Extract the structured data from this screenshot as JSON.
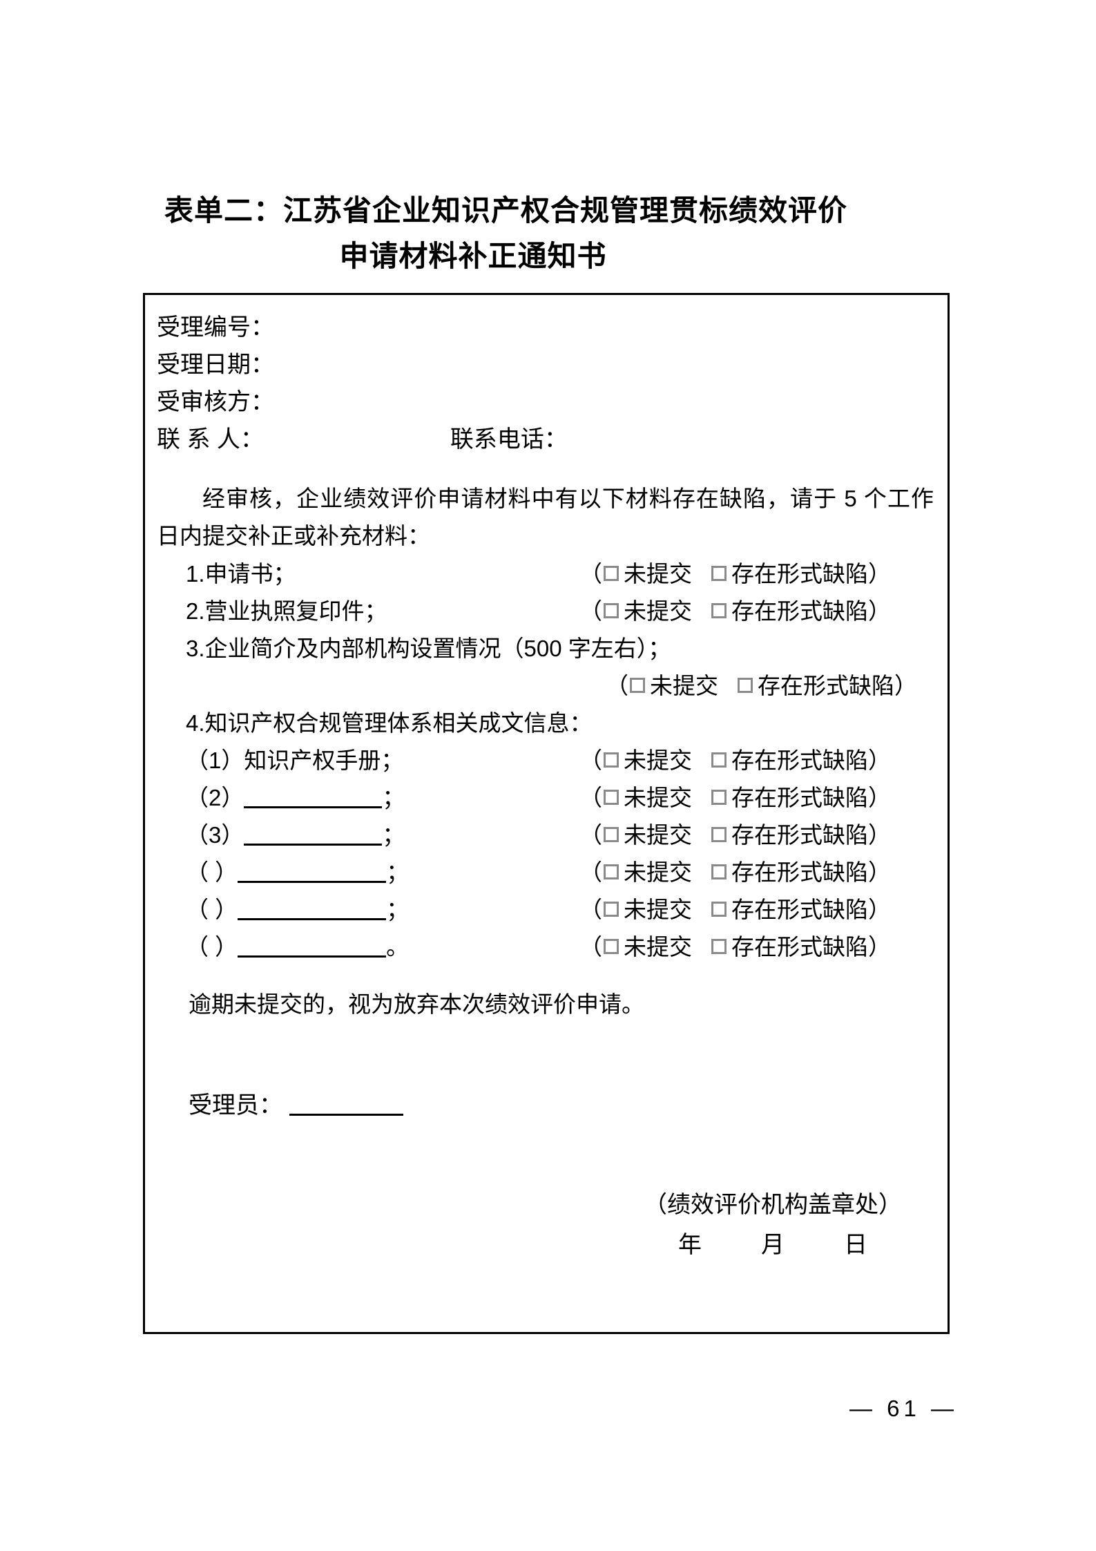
{
  "document": {
    "title_line_1": "表单二：江苏省企业知识产权合规管理贯标绩效评价",
    "title_line_2": "申请材料补正通知书",
    "page_number": "— 61 —"
  },
  "header_fields": {
    "case_number_label": "受理编号：",
    "accept_date_label": "受理日期：",
    "audited_party_label": "受审核方：",
    "contact_person_label": "联 系 人：",
    "contact_phone_label": "联系电话："
  },
  "body": {
    "intro": "经审核，企业绩效评价申请材料中有以下材料存在缺陷，请于 5 个工作日内提交补正或补充材料：",
    "closing": "逾期未提交的，视为放弃本次绩效评价申请。"
  },
  "options": {
    "paren_open": "（",
    "paren_close": "）",
    "not_submitted": "未提交",
    "format_defect": "存在形式缺陷"
  },
  "items": [
    {
      "label": "1.申请书；",
      "has_options": true,
      "blank": false
    },
    {
      "label": "2.营业执照复印件；",
      "has_options": true,
      "blank": false
    },
    {
      "label": "3.企业简介及内部机构设置情况（500 字左右）；",
      "has_options": false,
      "blank": false
    },
    {
      "label": "4.知识产权合规管理体系相关成文信息：",
      "has_options": false,
      "blank": false
    },
    {
      "label": "（1）知识产权手册；",
      "has_options": true,
      "blank": false
    },
    {
      "label": "（2）",
      "suffix": "；",
      "has_options": true,
      "blank": true
    },
    {
      "label": "（3）",
      "suffix": "；",
      "has_options": true,
      "blank": true
    },
    {
      "label": "（ ）",
      "suffix": "；",
      "has_options": true,
      "blank": true
    },
    {
      "label": "（ ）",
      "suffix": "；",
      "has_options": true,
      "blank": true
    },
    {
      "label": "（ ）",
      "suffix": "。",
      "has_options": true,
      "blank": true
    }
  ],
  "item3_options_line": true,
  "footer": {
    "receiver_label": "受理员：",
    "stamp_note": "（绩效评价机构盖章处）",
    "date_line": "年　月　日"
  }
}
